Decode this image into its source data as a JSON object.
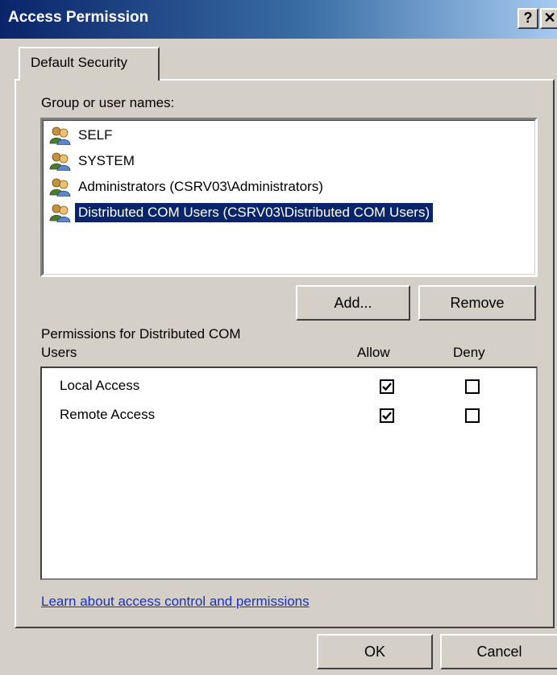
{
  "window": {
    "title": "Access Permission",
    "help_glyph": "?",
    "close_glyph": "✕"
  },
  "tabs": [
    {
      "label": "Default Security"
    }
  ],
  "groups": {
    "label": "Group or user names:",
    "items": [
      {
        "name": "SELF",
        "selected": false,
        "icon": "users-icon"
      },
      {
        "name": "SYSTEM",
        "selected": false,
        "icon": "users-icon"
      },
      {
        "name": "Administrators (CSRV03\\Administrators)",
        "selected": false,
        "icon": "users-icon"
      },
      {
        "name": "Distributed COM Users (CSRV03\\Distributed COM Users)",
        "selected": true,
        "icon": "users-icon"
      }
    ],
    "add_label": "Add...",
    "remove_label": "Remove"
  },
  "permissions": {
    "label_line1": "Permissions for Distributed COM",
    "label_line2": "Users",
    "allow_header": "Allow",
    "deny_header": "Deny",
    "rows": [
      {
        "name": "Local Access",
        "allow": true,
        "deny": false
      },
      {
        "name": "Remote Access",
        "allow": true,
        "deny": false
      }
    ]
  },
  "link": {
    "text": "Learn about access control and permissions"
  },
  "footer": {
    "ok_label": "OK",
    "cancel_label": "Cancel"
  },
  "colors": {
    "selection": "#0a246a",
    "title_start": "#0a246a",
    "title_end": "#a6caf0",
    "link": "#1a2fc4",
    "face": "#d4d0c8"
  }
}
